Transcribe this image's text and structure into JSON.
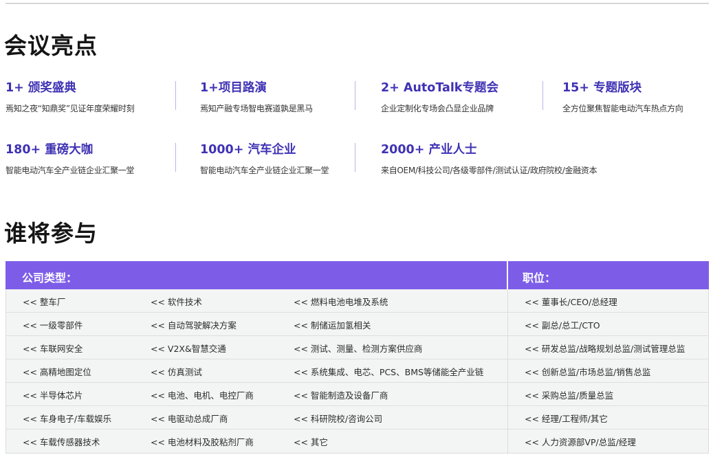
{
  "highlights_title": "会议亮点",
  "highlights": [
    {
      "num": "1+ 颁奖盛典",
      "desc": "焉知之夜“知鼎奖”见证年度荣耀时刻"
    },
    {
      "num": "1+项目路演",
      "desc": "焉知产融专场智电赛道孰是黑马"
    },
    {
      "num": "2+ AutoTalk专题会",
      "desc": "企业定制化专场会凸显企业品牌"
    },
    {
      "num": "15+ 专题版块",
      "desc": "全方位聚焦智能电动汽车热点方向"
    },
    {
      "num": "180+ 重磅大咖",
      "desc": "智能电动汽车全产业链企业汇聚一堂"
    },
    {
      "num": "1000+ 汽车企业",
      "desc": "智能电动汽车全产业链企业汇聚一堂"
    },
    {
      "num": "2000+ 产业人士",
      "desc": "来自OEM/科技公司/各级零部件/测试认证/政府院校/金融资本"
    }
  ],
  "participants_title": "谁将参与",
  "table": {
    "header_company": "公司类型：",
    "header_position": "职位：",
    "rows": [
      [
        "<< 整车厂",
        "<< 软件技术",
        "<< 燃料电池电堆及系统",
        "<< 董事长/CEO/总经理"
      ],
      [
        "<< 一级零部件",
        "<< 自动驾驶解决方案",
        "<< 制储运加氢相关",
        "<< 副总/总工/CTO"
      ],
      [
        "<< 车联网安全",
        "<< V2X&智慧交通",
        "<< 测试、测量、检测方案供应商",
        "<< 研发总监/战略规划总监/测试管理总监"
      ],
      [
        "<< 高精地图定位",
        "<< 仿真测试",
        "<< 系统集成、电芯、PCS、BMS等储能全产业链",
        "<< 创新总监/市场总监/销售总监"
      ],
      [
        "<< 半导体芯片",
        "<< 电池、电机、电控厂商",
        "<< 智能制造及设备厂商",
        "<< 采购总监/质量总监"
      ],
      [
        "<< 车身电子/车载娱乐",
        "<< 电驱动总成厂商",
        "<< 科研院校/咨询公司",
        "<< 经理/工程师/其它"
      ],
      [
        "<< 车载传感器技术",
        "<< 电池材料及胶粘剂厂商",
        "<< 其它",
        "<< 人力资源部VP/总监/经理"
      ]
    ]
  },
  "colors": {
    "accent": "#3f32b4",
    "header_bg": "#7d5de8",
    "row_bg": "#f3f4f4"
  }
}
